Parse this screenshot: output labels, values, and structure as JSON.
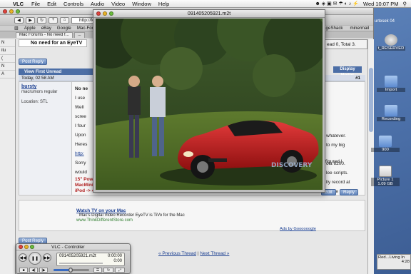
{
  "menubar": {
    "app": "VLC",
    "items": [
      "File",
      "Edit",
      "Controls",
      "Audio",
      "Video",
      "Window",
      "Help"
    ],
    "clock": "Wed 10:07 PM",
    "apple_glyph": "",
    "status_glyphs": "☻ ◈ ▣ ✉ ☂ ◐ ♪ ⚡"
  },
  "safari": {
    "url": "http://foru",
    "bookmarks": [
      "Apple",
      "eBay",
      "Google",
      "Mac-Forums"
    ],
    "bookmarks_right": [
      "ageShack",
      "minermail"
    ],
    "tabs": [
      "Mac Forums - No need f...",
      "..."
    ]
  },
  "leftstrip": {
    "rows": [
      "N",
      "itu",
      "(",
      "N",
      "A"
    ]
  },
  "page": {
    "need_title": "No need for an EyeTV",
    "post_reply": "Post Reply",
    "view_first_unread": "View First Unread",
    "display_modes": "Display Modes",
    "post_date": "Today, 02:58 AM",
    "post_number": "#1",
    "username": "bursty",
    "user_title": "macrumors regular",
    "location": "Location: STL",
    "message_lines": [
      "No ne",
      "I use",
      "Well",
      "scree",
      "",
      "I four",
      "Upon",
      "",
      "Heres",
      "",
      "http:",
      "",
      "Sorry",
      "would"
    ],
    "signature_line1": "15\" Powerb",
    "signature_line2": "MacMini ->",
    "signature_line3": "iPod -> 40",
    "right_fragments": [
      "whatever.",
      "to my big",
      "",
      "ola 6200.",
      "lee scripts.",
      "lly record at",
      "a little",
      "",
      "figured I"
    ],
    "edit": "Edit",
    "reply": "Reply",
    "ad_title": "Watch TV on your Mac",
    "ad_desc": "Mac's Digital Video Recorder EyeTV is TiVo for the Mac",
    "ad_url": "www.ThinkDifferentStore.com",
    "ads_by": "Ads by Goooooogle",
    "prev_thread": "« Previous Thread",
    "sep": "|",
    "next_thread": "Next Thread »"
  },
  "popup_window": {
    "text": "ead 0, Total 3."
  },
  "video_window": {
    "title": "091405205921.m2t",
    "watermark": "DISCOVERY"
  },
  "desktop_icons": [
    {
      "label": ""
    },
    {
      "label": "t_RESERVED"
    },
    {
      "label": "Import"
    },
    {
      "label": "Recording"
    },
    {
      "label": "900"
    },
    {
      "label": "Picture 1"
    },
    {
      "label": "1.09 GB"
    }
  ],
  "app_fragment": {
    "text": "urtesek 04"
  },
  "mail_panel": {
    "line1": "Red...Living In",
    "line2": "4:28"
  },
  "vlc_controller": {
    "title": "VLC - Controller",
    "filename": "091405205921.m2t",
    "time": "0:00:00",
    "time2": "0:00",
    "volume_level": 0.48,
    "position": 0.0
  }
}
